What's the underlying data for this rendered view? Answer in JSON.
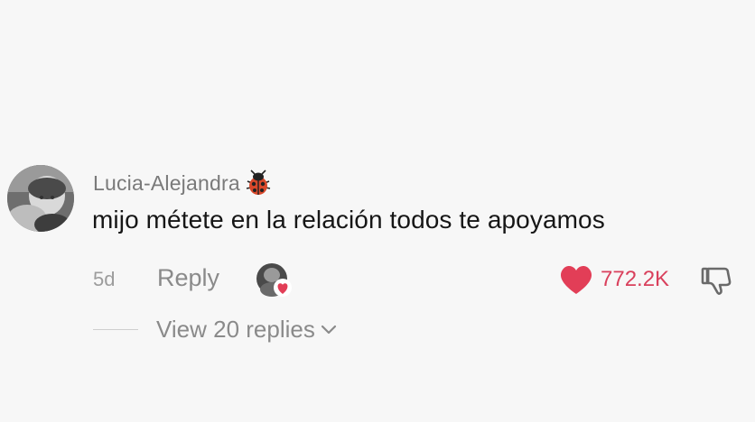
{
  "comment": {
    "username": "Lucia-Alejandra",
    "badge_icon": "ladybug-icon",
    "text": "mijo métete en la relación todos te apoyamos",
    "timestamp": "5d",
    "reply_label": "Reply",
    "liked_by_creator_icon": "creator-liked-icon",
    "like_count": "772.2K",
    "liked": true,
    "colors": {
      "like_accent": "#e23e57",
      "username": "#7a7a7a",
      "text": "#161616",
      "meta": "#8a8a8a"
    }
  },
  "replies": {
    "label": "View 20 replies",
    "expand_icon": "chevron-down-icon"
  }
}
